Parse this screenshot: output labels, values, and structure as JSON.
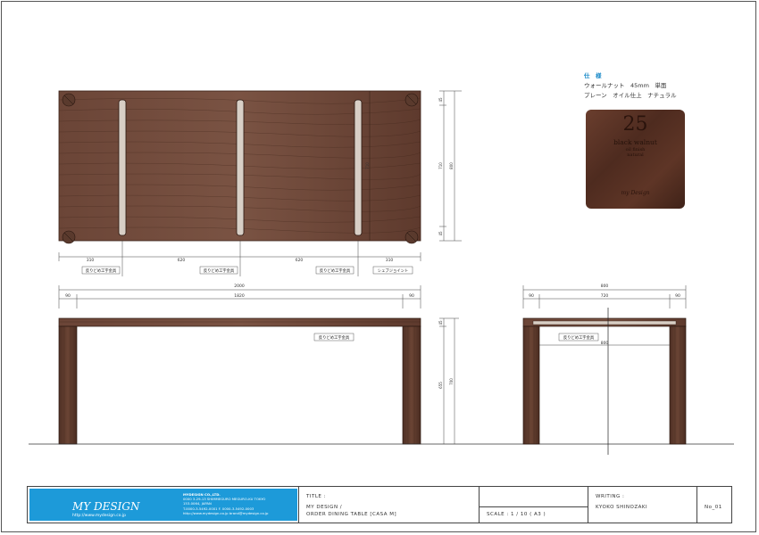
{
  "spec": {
    "heading": "仕　様",
    "line1": "ウォールナット　45mm　単面",
    "line2": "プレーン　オイル仕上　ナチュラル",
    "sample_number": "25",
    "sample_line1": "black walnut",
    "sample_line2": "oil finish",
    "sample_line3": "natural",
    "sample_brand": "my Design"
  },
  "plan_dims": {
    "bottom": [
      "310",
      "620",
      "620",
      "310"
    ],
    "right_outer": "800",
    "right_inner": "710",
    "right_top": "45",
    "right_bottom": "45"
  },
  "callouts": {
    "plan_1": "反りどめ工字金具",
    "plan_2": "反りどめ工字金具",
    "plan_3": "反りどめ工字金具",
    "plan_4": "シェブジョイント",
    "front": "反りどめ工字金具",
    "side": "反りどめ工字金具"
  },
  "front_dims": {
    "total": "2000",
    "left": "90",
    "middle": "1820",
    "right": "90",
    "height_top": "45",
    "height_leg": "655",
    "height_total": "700"
  },
  "side_dims": {
    "total": "800",
    "left": "90",
    "middle": "720",
    "right": "90",
    "inner": "800"
  },
  "title_block": {
    "logo": "MY DESIGN",
    "logo_url": "http://www.mydesign.co.jp",
    "company_lines": [
      "MYDESIGN CO.,LTD.",
      "0000 3-29-13 SHIMMEGURO MEGURO-KU TOKYO",
      "153-0064, JAPAN",
      "T.0000-3-5492-0001  F. 0000-3-5492-0003",
      "http://www.mydesign.co.jp  brand@mydesign.co.jp"
    ],
    "title_label": "TITLE :",
    "title_line1": "MY DESIGN /",
    "title_line2": "ORDER DINING TABLE  [CASA M]",
    "scale": "SCALE : 1 / 10 ( A3 )",
    "writing_label": "WRITING :",
    "writer": "KYOKO SHINOZAKI",
    "sheet_no": "No_01"
  },
  "colors": {
    "wood": "#6e4a3c",
    "wood_dark": "#4a2e22",
    "accent": "#1d9ad9"
  }
}
